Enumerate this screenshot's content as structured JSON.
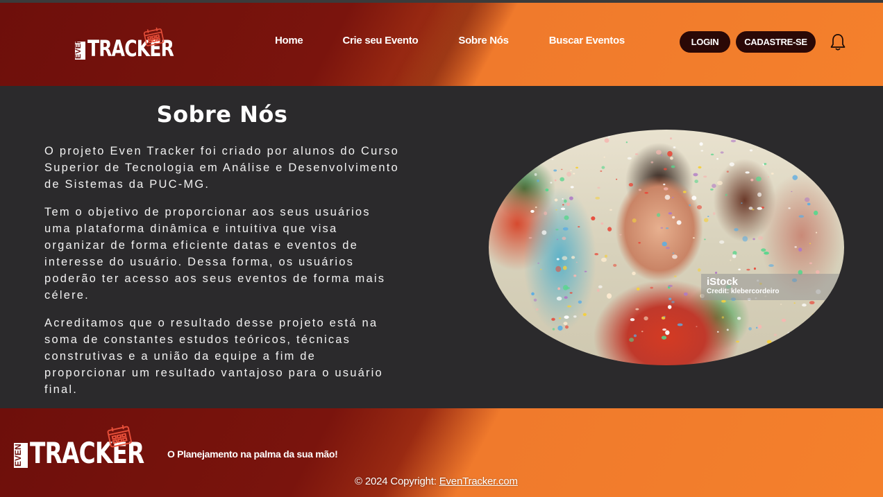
{
  "header": {
    "logo": {
      "even": "EVEN",
      "tracker": "TRACKER"
    },
    "nav": [
      {
        "label": "Home"
      },
      {
        "label": "Crie seu Evento"
      },
      {
        "label": "Sobre Nós"
      },
      {
        "label": "Buscar Eventos"
      }
    ],
    "login_label": "LOGIN",
    "signup_label": "CADASTRE-SE",
    "notification_icon": "bell-icon"
  },
  "about": {
    "title": "Sobre Nós",
    "paragraphs": [
      "O projeto Even Tracker foi criado por alunos do Curso Superior de Tecnologia em Análise e Desenvolvimento de Sistemas da PUC-MG.",
      "Tem o objetivo de proporcionar aos seus usuários uma plataforma dinâmica e intuitiva que visa organizar de forma eficiente datas e eventos de interesse do usuário. Dessa forma, os usuários poderão ter acesso aos seus eventos de forma mais célere.",
      "Acreditamos que o resultado desse projeto está na soma de constantes estudos teóricos, técnicas construtivas e a união da equipe a fim de proporcionar um resultado vantajoso para o usuário final."
    ],
    "image": {
      "watermark_brand": "iStock",
      "watermark_credit": "Credit: klebercordeiro"
    }
  },
  "footer": {
    "logo": {
      "even": "EVEN",
      "tracker": "TRACKER"
    },
    "tagline": "O Planejamento na palma da sua mão!",
    "copyright_prefix": "© 2024 Copyright: ",
    "copyright_link": "EvenTracker.com"
  },
  "colors": {
    "brand_dark": "#6e0f0b",
    "brand_orange": "#f4802c",
    "button_bg": "#2a0806",
    "main_bg": "#2b2a2c"
  }
}
